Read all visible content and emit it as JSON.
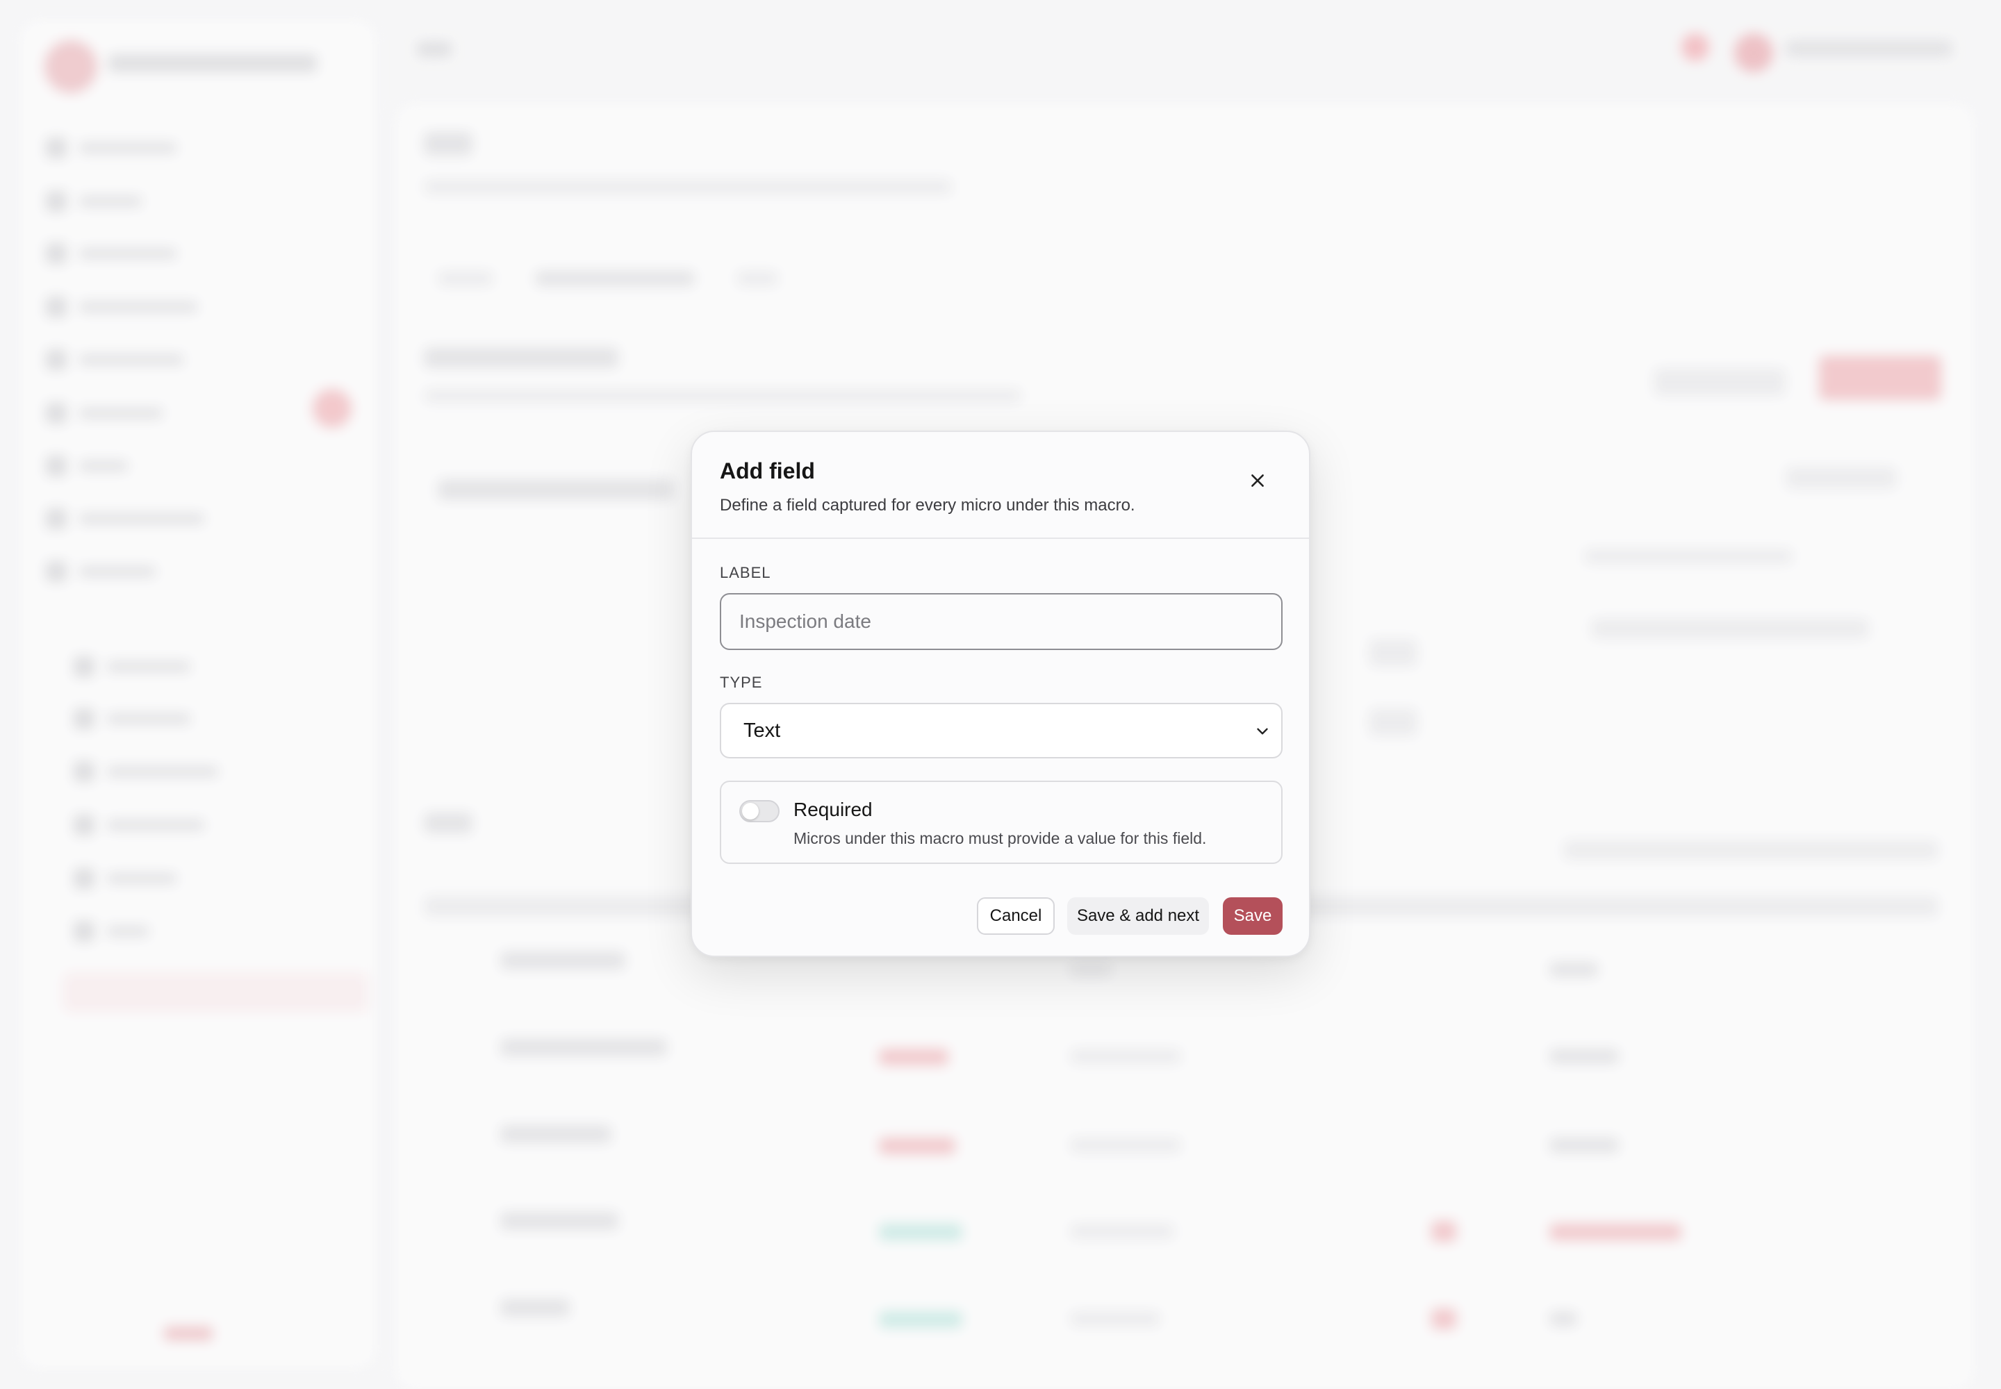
{
  "modal": {
    "title": "Add field",
    "subtitle": "Define a field captured for every micro under this macro.",
    "close_icon": "close-icon",
    "label_field": {
      "label": "LABEL",
      "placeholder": "Inspection date",
      "value": ""
    },
    "type_field": {
      "label": "TYPE",
      "selected": "Text",
      "chevron_icon": "chevron-down-icon"
    },
    "required": {
      "title": "Required",
      "description": "Micros under this macro must provide a value for this field.",
      "enabled": false
    },
    "actions": {
      "cancel": "Cancel",
      "save_next": "Save & add next",
      "save": "Save"
    }
  },
  "colors": {
    "accent": "#b4505a",
    "border": "#d9d9dc",
    "text": "#161616"
  }
}
